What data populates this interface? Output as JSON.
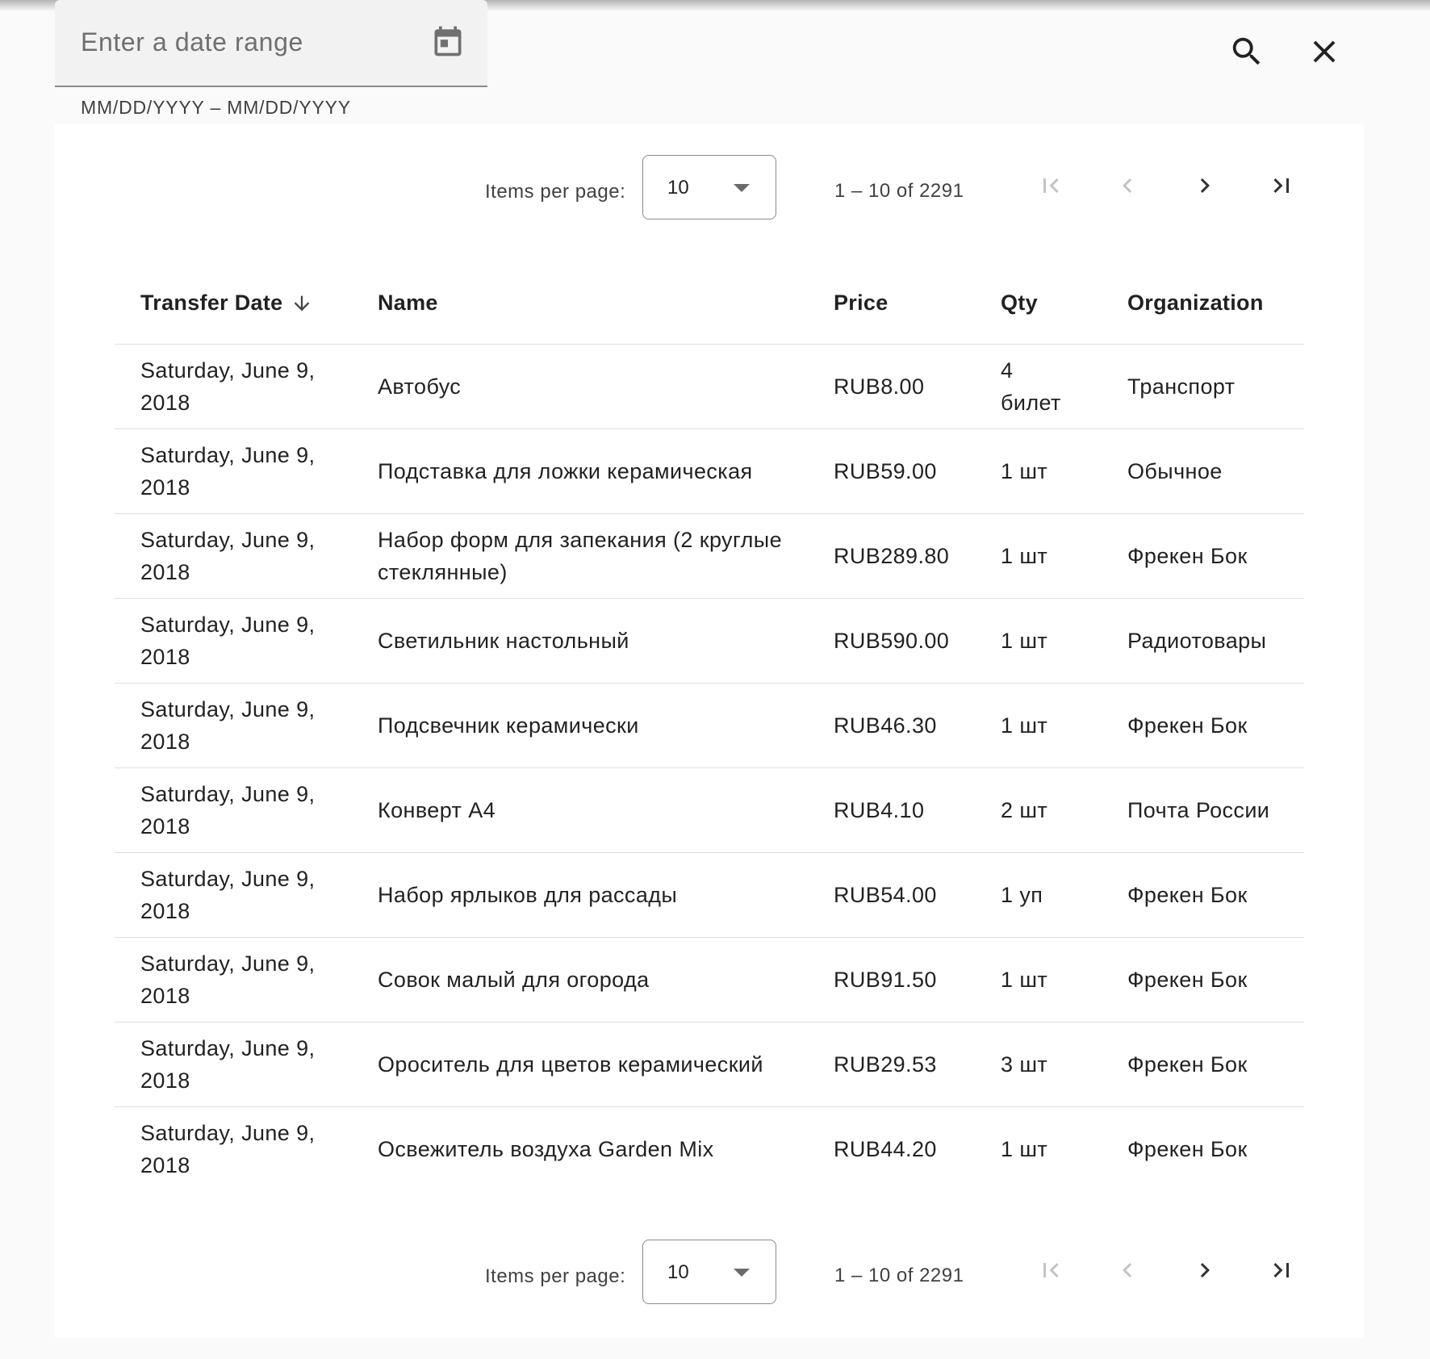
{
  "date_filter": {
    "placeholder": "Enter a date range",
    "hint": "MM/DD/YYYY – MM/DD/YYYY"
  },
  "icons": {
    "calendar": "calendar-icon",
    "search": "search-icon",
    "close": "close-icon",
    "sort": "arrow-down-icon",
    "first_page": "first-page-icon",
    "prev_page": "chevron-left-icon",
    "next_page": "chevron-right-icon",
    "last_page": "last-page-icon"
  },
  "paginator": {
    "items_per_page_label": "Items per page:",
    "page_size": "10",
    "range_label": "1 – 10 of 2291"
  },
  "table": {
    "columns": {
      "date": "Transfer Date",
      "name": "Name",
      "price": "Price",
      "qty": "Qty",
      "org": "Organization"
    },
    "rows": [
      {
        "date": "Saturday, June 9, 2018",
        "name": "Автобус",
        "price": "RUB8.00",
        "qty": "4 билет",
        "org": "Транспорт"
      },
      {
        "date": "Saturday, June 9, 2018",
        "name": "Подставка для ложки керамическая",
        "price": "RUB59.00",
        "qty": "1 шт",
        "org": "Обычное"
      },
      {
        "date": "Saturday, June 9, 2018",
        "name": "Набор форм для запекания (2 круглые стеклянные)",
        "price": "RUB289.80",
        "qty": "1 шт",
        "org": "Фрекен Бок"
      },
      {
        "date": "Saturday, June 9, 2018",
        "name": "Светильник настольный",
        "price": "RUB590.00",
        "qty": "1 шт",
        "org": "Радиотовары"
      },
      {
        "date": "Saturday, June 9, 2018",
        "name": "Подсвечник керамически",
        "price": "RUB46.30",
        "qty": "1 шт",
        "org": "Фрекен Бок"
      },
      {
        "date": "Saturday, June 9, 2018",
        "name": "Конверт А4",
        "price": "RUB4.10",
        "qty": "2 шт",
        "org": "Почта России"
      },
      {
        "date": "Saturday, June 9, 2018",
        "name": "Набор ярлыков для рассады",
        "price": "RUB54.00",
        "qty": "1 уп",
        "org": "Фрекен Бок"
      },
      {
        "date": "Saturday, June 9, 2018",
        "name": "Совок малый для огорода",
        "price": "RUB91.50",
        "qty": "1 шт",
        "org": "Фрекен Бок"
      },
      {
        "date": "Saturday, June 9, 2018",
        "name": "Ороситель для цветов керамический",
        "price": "RUB29.53",
        "qty": "3 шт",
        "org": "Фрекен Бок"
      },
      {
        "date": "Saturday, June 9, 2018",
        "name": "Освежитель воздуха Garden Mix",
        "price": "RUB44.20",
        "qty": "1 шт",
        "org": "Фрекен Бок"
      }
    ]
  }
}
